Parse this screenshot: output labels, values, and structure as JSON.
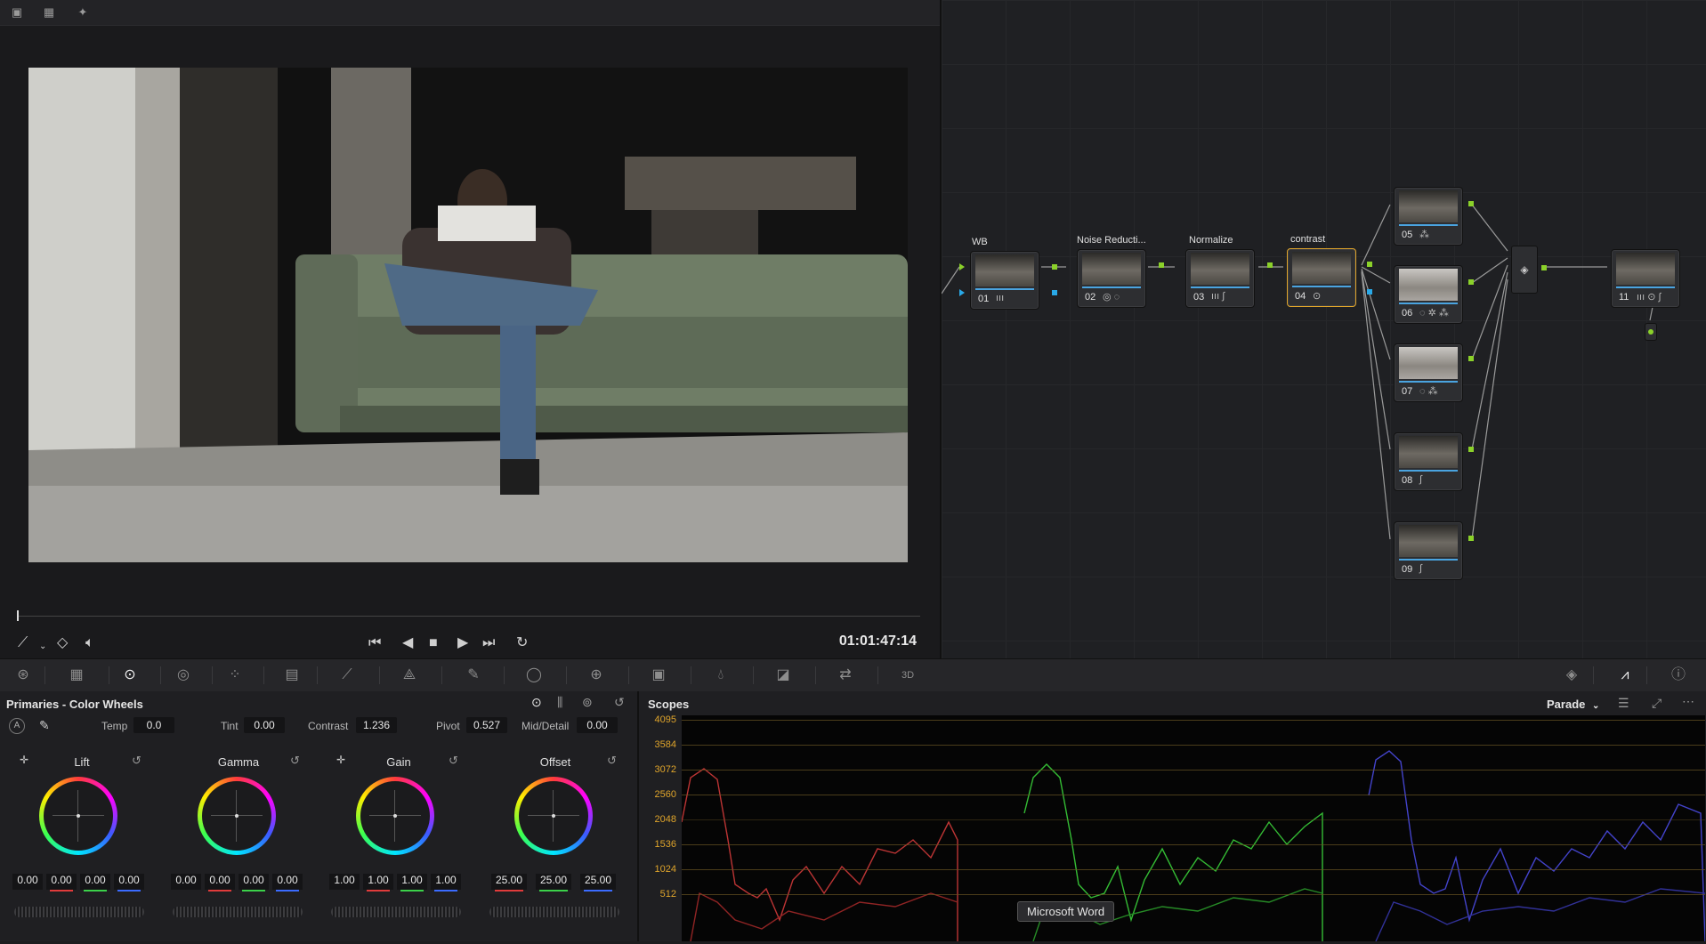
{
  "viewer": {
    "timecode": "01:01:47:14"
  },
  "nodes": [
    {
      "num": "01",
      "label": "WB"
    },
    {
      "num": "02",
      "label": "Noise Reducti..."
    },
    {
      "num": "03",
      "label": "Normalize"
    },
    {
      "num": "04",
      "label": "contrast"
    },
    {
      "num": "05",
      "label": ""
    },
    {
      "num": "06",
      "label": ""
    },
    {
      "num": "07",
      "label": ""
    },
    {
      "num": "08",
      "label": ""
    },
    {
      "num": "09",
      "label": ""
    },
    {
      "num": "11",
      "label": ""
    }
  ],
  "primaries": {
    "title": "Primaries - Color Wheels",
    "temp_label": "Temp",
    "temp": "0.0",
    "tint_label": "Tint",
    "tint": "0.00",
    "contrast_label": "Contrast",
    "contrast": "1.236",
    "pivot_label": "Pivot",
    "pivot": "0.527",
    "middetail_label": "Mid/Detail",
    "middetail": "0.00",
    "wheels": [
      {
        "name": "Lift",
        "values": [
          "0.00",
          "0.00",
          "0.00",
          "0.00"
        ]
      },
      {
        "name": "Gamma",
        "values": [
          "0.00",
          "0.00",
          "0.00",
          "0.00"
        ]
      },
      {
        "name": "Gain",
        "values": [
          "1.00",
          "1.00",
          "1.00",
          "1.00"
        ]
      },
      {
        "name": "Offset",
        "values": [
          "25.00",
          "25.00",
          "25.00"
        ]
      }
    ]
  },
  "scopes": {
    "title": "Scopes",
    "mode": "Parade",
    "y_labels": [
      "4095",
      "3584",
      "3072",
      "2560",
      "2048",
      "1536",
      "1024",
      "512"
    ]
  },
  "tooltip": "Microsoft Word",
  "colors": {
    "accent": "#e0a52b",
    "node_green": "#8bd12a",
    "node_blue": "#29a9e8"
  }
}
